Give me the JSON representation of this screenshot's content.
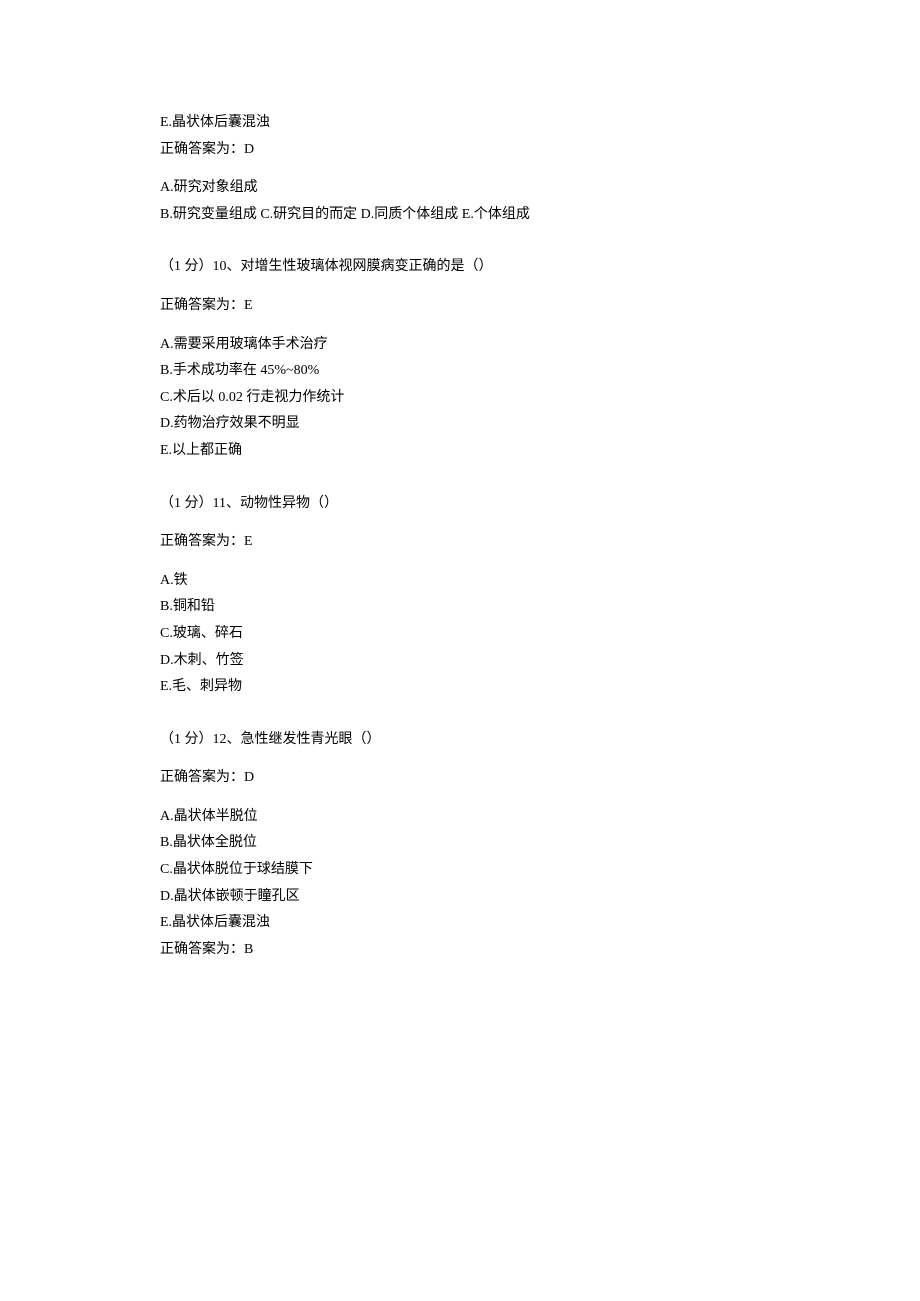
{
  "q9_tail": {
    "optionE": "E.晶状体后囊混浊",
    "answer": "正确答案为：D",
    "spacer": "",
    "optA": "A.研究对象组成",
    "optRest": "B.研究变量组成 C.研究目的而定 D.同质个体组成 E.个体组成"
  },
  "q10": {
    "header": "（1 分）10、对增生性玻璃体视网膜病变正确的是（）",
    "answer": "正确答案为：E",
    "optA": "A.需要采用玻璃体手术治疗",
    "optB": "B.手术成功率在 45%~80%",
    "optC": "C.术后以 0.02 行走视力作统计",
    "optD": "D.药物治疗效果不明显",
    "optE": "E.以上都正确"
  },
  "q11": {
    "header": "（1 分）11、动物性异物（）",
    "answer": "正确答案为：E",
    "optA": "A.铁",
    "optB": "B.铜和铅",
    "optC": "C.玻璃、碎石",
    "optD": "D.木刺、竹签",
    "optE": "E.毛、刺异物"
  },
  "q12": {
    "header": "（1 分）12、急性继发性青光眼（）",
    "answer": "正确答案为：D",
    "optA": "A.晶状体半脱位",
    "optB": "B.晶状体全脱位",
    "optC": "C.晶状体脱位于球结膜下",
    "optD": "D.晶状体嵌顿于瞳孔区",
    "optE": "E.晶状体后囊混浊",
    "answer2": "正确答案为：B"
  }
}
